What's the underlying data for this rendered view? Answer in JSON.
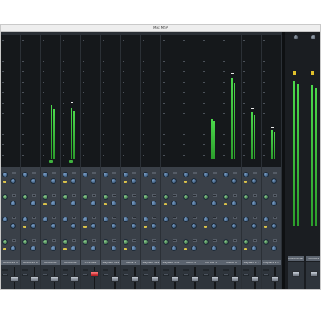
{
  "window": {
    "title": "Mix: MSP"
  },
  "header": {
    "groups": [
      "",
      "",
      "",
      ""
    ]
  },
  "channels": [
    {
      "name": "Ambience 1",
      "meter": 0.0,
      "peak": 0.0,
      "selected": false,
      "record": false
    },
    {
      "name": "Ambience 2",
      "meter": 0.0,
      "peak": 0.0,
      "selected": false,
      "record": false
    },
    {
      "name": "Ambient 1",
      "meter": 0.48,
      "peak": 0.52,
      "selected": false,
      "record": true
    },
    {
      "name": "Ambient 2",
      "meter": 0.46,
      "peak": 0.5,
      "selected": false,
      "record": true
    },
    {
      "name": "Clicktrack",
      "meter": 0.0,
      "peak": 0.0,
      "selected": true,
      "record": false
    },
    {
      "name": "Playback 1+2",
      "meter": 0.0,
      "peak": 0.0,
      "selected": false,
      "record": false
    },
    {
      "name": "Stems 1",
      "meter": 0.0,
      "peak": 0.0,
      "selected": false,
      "record": false
    },
    {
      "name": "Playback 3+4",
      "meter": 0.0,
      "peak": 0.0,
      "selected": false,
      "record": false
    },
    {
      "name": "Playback 5+6",
      "meter": 0.0,
      "peak": 0.0,
      "selected": false,
      "record": false
    },
    {
      "name": "Stems 2",
      "meter": 0.0,
      "peak": 0.0,
      "selected": false,
      "record": false
    },
    {
      "name": "Vox Dbl 1",
      "meter": 0.36,
      "peak": 0.38,
      "selected": false,
      "record": false
    },
    {
      "name": "Vox Dbl 2",
      "meter": 0.72,
      "peak": 0.76,
      "selected": false,
      "record": false
    },
    {
      "name": "Playback 1 L",
      "meter": 0.42,
      "peak": 0.44,
      "selected": false,
      "record": false
    },
    {
      "name": "Playback 1 R",
      "meter": 0.26,
      "peak": 0.28,
      "selected": false,
      "record": false
    }
  ],
  "master": {
    "left": {
      "name": "Headphones 1",
      "meter": 0.86,
      "peak": 0.9
    },
    "right": {
      "name": "Monitors",
      "meter": 0.84,
      "peak": 0.9
    }
  },
  "colors": {
    "meter": "#3fbf3f",
    "selected_fader": "#d1232a",
    "peak_hold": "#e1c12c"
  }
}
